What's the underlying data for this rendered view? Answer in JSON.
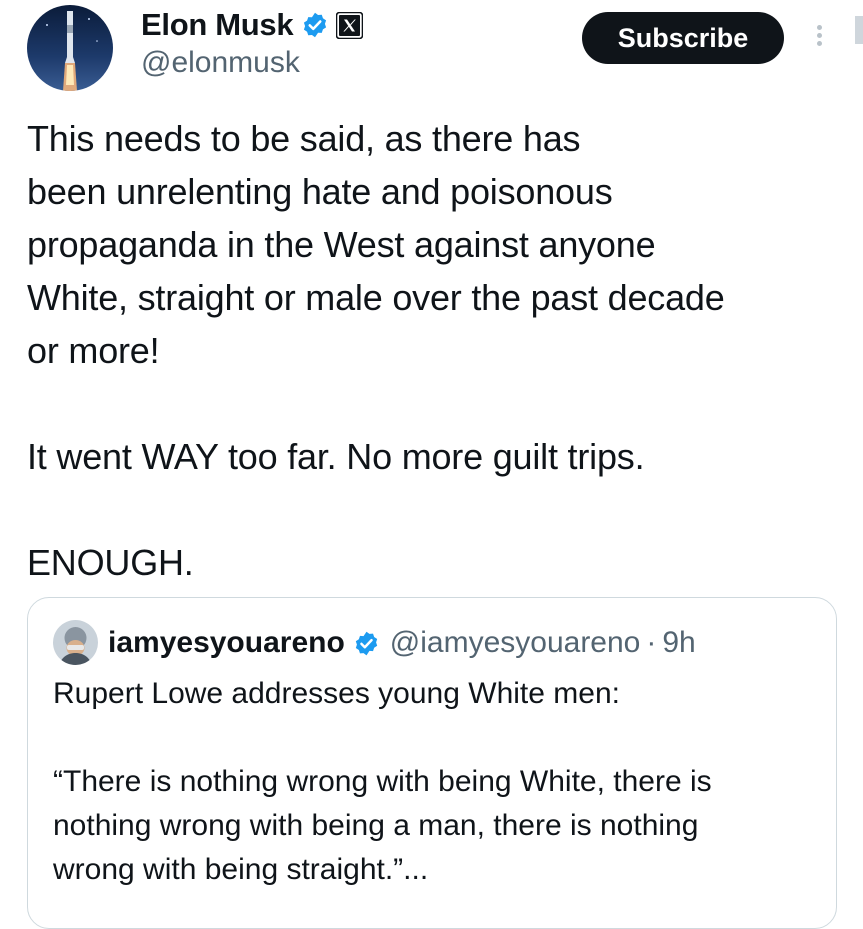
{
  "author": {
    "name": "Elon Musk",
    "handle": "@elonmusk",
    "avatar_icon": "rocket-launch-avatar",
    "verified_color": "#1d9bf0"
  },
  "actions": {
    "subscribe_label": "Subscribe",
    "more_icon": "more-vertical-icon"
  },
  "tweet": {
    "lines": [
      "This needs to be said, as there has",
      "been unrelenting hate and poisonous",
      "propaganda in the West against anyone",
      "White, straight or male over the past decade",
      "or more!"
    ],
    "line2": "It went WAY too far. No more guilt trips.",
    "line3": "ENOUGH."
  },
  "quoted": {
    "name": "iamyesyouareno",
    "handle": "@iamyesyouareno",
    "separator": "·",
    "time": "9h",
    "intro": "Rupert Lowe addresses young White men:",
    "quote_lines": [
      "“There is nothing wrong with being White, there is",
      "nothing wrong with being a man, there is nothing",
      "wrong with being straight.”..."
    ]
  }
}
